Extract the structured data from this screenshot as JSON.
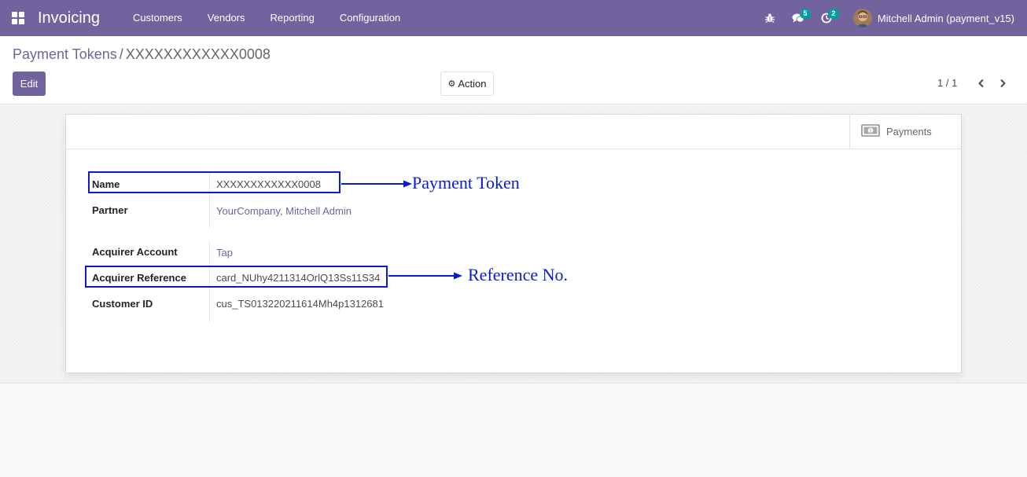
{
  "navbar": {
    "app_name": "Invoicing",
    "menu": [
      "Customers",
      "Vendors",
      "Reporting",
      "Configuration"
    ],
    "messages_count": "5",
    "activities_count": "2",
    "user_name": "Mitchell Admin (payment_v15)",
    "accent_color": "#71639e"
  },
  "breadcrumb": {
    "parent": "Payment Tokens",
    "separator": "/",
    "current": "XXXXXXXXXXXX0008"
  },
  "buttons": {
    "edit": "Edit",
    "action": "Action"
  },
  "pager": {
    "value": "1 / 1"
  },
  "stat_buttons": {
    "payments": "Payments"
  },
  "fields": {
    "name_label": "Name",
    "name_value": "XXXXXXXXXXXX0008",
    "partner_label": "Partner",
    "partner_value": "YourCompany, Mitchell Admin",
    "acquirer_account_label": "Acquirer Account",
    "acquirer_account_value": "Tap",
    "acquirer_reference_label": "Acquirer Reference",
    "acquirer_reference_value": "card_NUhy4211314OrlQ13Ss11S34",
    "customer_id_label": "Customer ID",
    "customer_id_value": "cus_TS013220211614Mh4p1312681"
  },
  "annotations": {
    "payment_token": "Payment Token",
    "reference_no": "Reference No.",
    "color": "#0a1bd1"
  },
  "icons": [
    "apps-grid-icon",
    "bug-icon",
    "chat-icon",
    "clock-icon",
    "gear-icon",
    "chevron-left-icon",
    "chevron-right-icon",
    "money-icon"
  ]
}
